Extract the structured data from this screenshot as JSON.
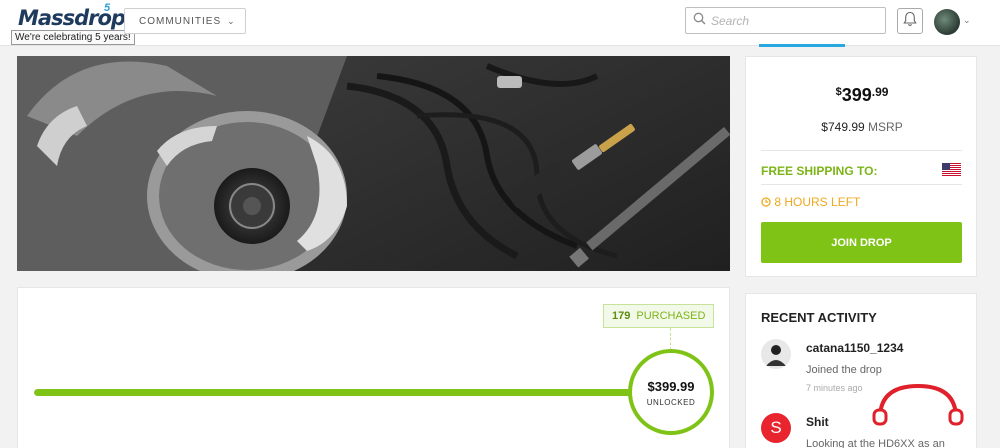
{
  "header": {
    "logo": "Massdrop",
    "logo_badge": "5",
    "tooltip": "We're celebrating 5 years!",
    "communities_label": "COMMUNITIES",
    "search_placeholder": "Search"
  },
  "price_card": {
    "currency": "$",
    "price_main": "399",
    "price_cents": ".99",
    "msrp_value": "$749.99",
    "msrp_label": "MSRP",
    "free_shipping": "FREE SHIPPING TO:",
    "time_left": "8 HOURS LEFT",
    "join_button": "JOIN DROP"
  },
  "progress": {
    "purchased_count": "179",
    "purchased_label": "PURCHASED",
    "fill_fraction": 1.0,
    "milestone_price": "$399.99",
    "milestone_label": "UNLOCKED"
  },
  "activity": {
    "title": "RECENT ACTIVITY",
    "items": [
      {
        "user": "catana1150_1234",
        "text": "Joined the drop",
        "time": "7 minutes ago",
        "avatar_letter": ""
      },
      {
        "user": "Shit",
        "text": "Looking at the HD6XX as an",
        "time": "",
        "avatar_letter": "S"
      }
    ]
  },
  "colors": {
    "accent_green": "#7fc316",
    "warning_orange": "#f0a81c",
    "brand_blue": "#1e3a5c"
  }
}
